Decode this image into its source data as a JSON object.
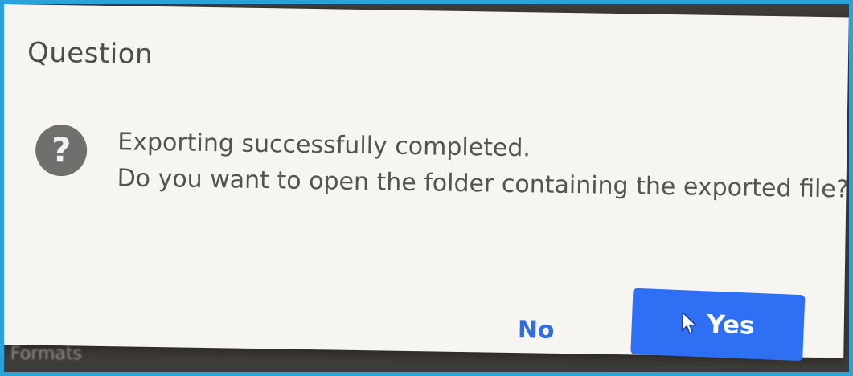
{
  "dialog": {
    "title": "Question",
    "icon": "question-icon",
    "message_line1": "Exporting successfully completed.",
    "message_line2": "Do you want to open the folder containing the exported file?",
    "no_label": "No",
    "yes_label": "Yes"
  },
  "background": {
    "partial_text": "Formats"
  },
  "colors": {
    "accent": "#2f6ff3",
    "border": "#2aa3d8",
    "dialog_bg": "#f7f5f2",
    "icon_bg": "#6f6f6d"
  }
}
